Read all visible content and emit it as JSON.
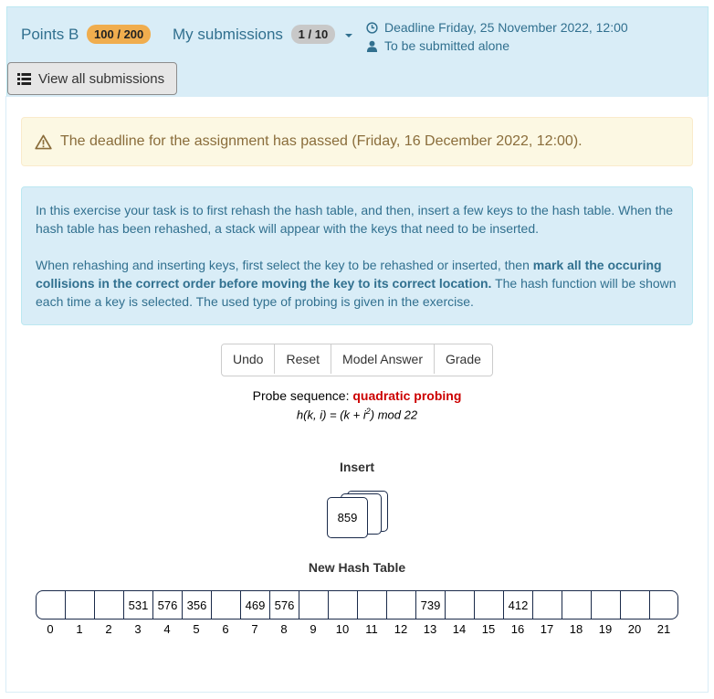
{
  "header": {
    "points_label": "Points B",
    "points_badge": "100 / 200",
    "submissions_label": "My submissions",
    "submissions_badge": "1 / 10",
    "deadline_text": "Deadline Friday, 25 November 2022, 12:00",
    "group_text": "To be submitted alone",
    "view_all_label": "View all submissions"
  },
  "alert": {
    "text": "The deadline for the assignment has passed (Friday, 16 December 2022, 12:00)."
  },
  "instructions": {
    "p1": "In this exercise your task is to first rehash the hash table, and then, insert a few keys to the hash table. When the hash table has been rehashed, a stack will appear with the keys that need to be inserted.",
    "p2_pre": "When rehashing and inserting keys, first select the key to be rehashed or inserted, then ",
    "p2_bold": "mark all the occuring collisions in the correct order before moving the key to its correct location.",
    "p2_post": " The hash function will be shown each time a key is selected. The used type of probing is given in the exercise."
  },
  "toolbar": {
    "undo": "Undo",
    "reset": "Reset",
    "model_answer": "Model Answer",
    "grade": "Grade"
  },
  "probe": {
    "label": "Probe sequence:",
    "type": "quadratic probing",
    "formula_pre": "h(k, i) = (k + i",
    "formula_sup": "2",
    "formula_post": ") mod 22"
  },
  "insert": {
    "title": "Insert",
    "current_key": "859"
  },
  "hash_table": {
    "title": "New Hash Table",
    "cells": [
      "",
      "",
      "",
      "531",
      "576",
      "356",
      "",
      "469",
      "576",
      "",
      "",
      "",
      "",
      "739",
      "",
      "",
      "412",
      "",
      "",
      "",
      "",
      ""
    ],
    "indices": [
      "0",
      "1",
      "2",
      "3",
      "4",
      "5",
      "6",
      "7",
      "8",
      "9",
      "10",
      "11",
      "12",
      "13",
      "14",
      "15",
      "16",
      "17",
      "18",
      "19",
      "20",
      "21"
    ]
  },
  "colors": {
    "info_bg": "#d9edf7",
    "info_text": "#31708f",
    "warning_bg": "#fcf8e3",
    "warning_text": "#8a6d3b",
    "points_badge": "#f0ad4e",
    "probe_red": "#cc0000"
  }
}
